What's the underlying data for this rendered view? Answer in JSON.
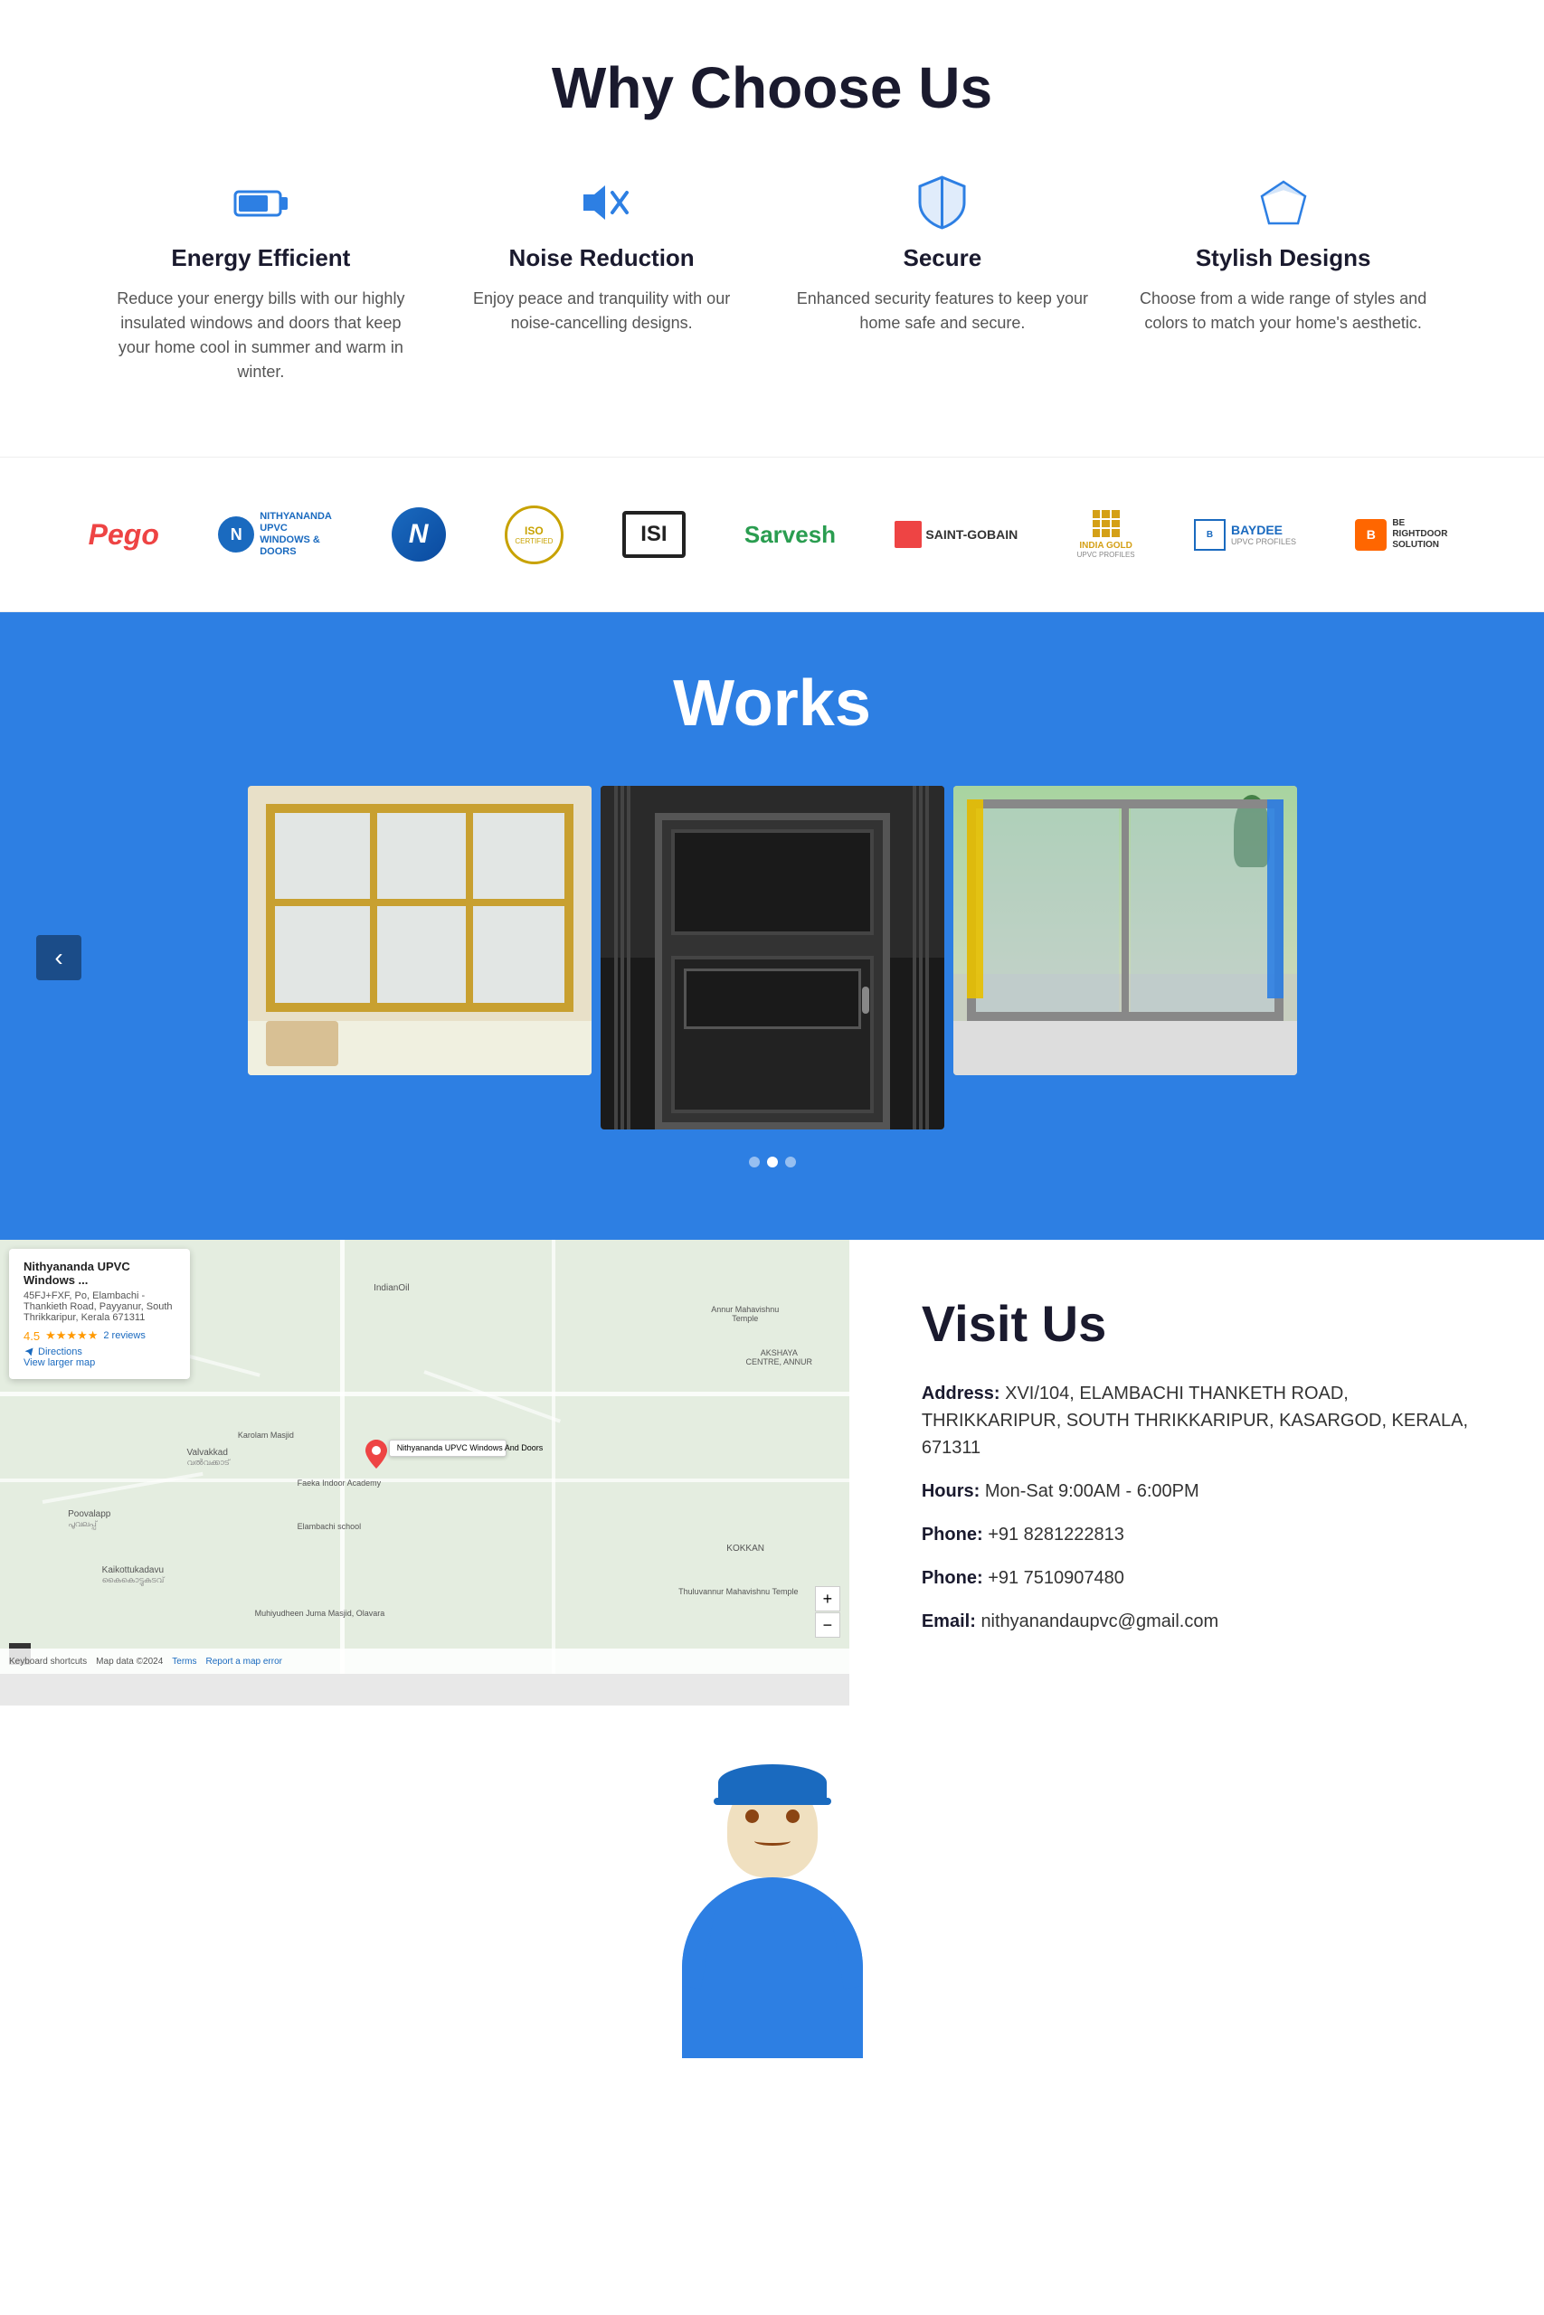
{
  "why": {
    "title": "Why Choose Us",
    "features": [
      {
        "id": "energy",
        "title": "Energy Efficient",
        "desc": "Reduce your energy bills with our highly insulated windows and doors that keep your home cool in summer and warm in winter.",
        "icon": "battery-icon"
      },
      {
        "id": "noise",
        "title": "Noise Reduction",
        "desc": "Enjoy peace and tranquility with our noise-cancelling designs.",
        "icon": "mute-icon"
      },
      {
        "id": "secure",
        "title": "Secure",
        "desc": "Enhanced security features to keep your home safe and secure.",
        "icon": "shield-icon"
      },
      {
        "id": "stylish",
        "title": "Stylish Designs",
        "desc": "Choose from a wide range of styles and colors to match your home's aesthetic.",
        "icon": "diamond-icon"
      }
    ]
  },
  "brands": {
    "items": [
      {
        "name": "Pego",
        "style": "pego"
      },
      {
        "name": "Nithyananda UPVC Windows & Doors",
        "style": "nithyananda"
      },
      {
        "name": "N",
        "style": "n-logo"
      },
      {
        "name": "ISO Certified",
        "style": "iso"
      },
      {
        "name": "ISI",
        "style": "isi"
      },
      {
        "name": "Sarvesh",
        "style": "sarvesh"
      },
      {
        "name": "SAINT-GOBAIN",
        "style": "saintgobain"
      },
      {
        "name": "INDIA GOLD UPVC PROFILES",
        "style": "india"
      },
      {
        "name": "BAYDEE UPVC PROFILES",
        "style": "baydee"
      },
      {
        "name": "BE RIGHTDOOR SOLUTION",
        "style": "be"
      }
    ]
  },
  "works": {
    "title": "Works",
    "images": [
      {
        "alt": "Yellow frame window installation"
      },
      {
        "alt": "Dark door installation"
      },
      {
        "alt": "Sliding window installation"
      }
    ],
    "dots": [
      false,
      true,
      false
    ]
  },
  "map": {
    "business_name": "Nithyananda UPVC Windows ...",
    "address": "45FJ+FXF, Po, Elambachi - Thankieth Road, Payyanur, South Thrikkaripur, Kerala 671311",
    "rating": "4.5",
    "stars": "★★★★★",
    "reviews_count": "2 reviews",
    "directions_label": "Directions",
    "view_larger": "View larger map",
    "labels": [
      "IndianOil",
      "Annur Mahavishnu Temple",
      "AKSHAYA CENTRE, ANNUR",
      "Valvakkad",
      "Poovalapp",
      "Kaikottukadavu",
      "Elambachi school",
      "Faeka Indoor Academy",
      "Karolam Masjid",
      "KOKKAN",
      "Thuluvannur Mahavishnu Temple",
      "Muhiyudheen Juma Masjid, Olavara"
    ],
    "pin_label": "Nithyananda UPVC Windows And Doors",
    "keyboard_shortcuts": "Keyboard shortcuts",
    "map_data": "Map data ©2024",
    "terms": "Terms",
    "report": "Report a map error"
  },
  "visit": {
    "title": "Visit Us",
    "address_label": "Address:",
    "address_value": "XVI/104, ELAMBACHI THANKETH ROAD, THRIKKARIPUR, SOUTH THRIKKARIPUR, KASARGOD, KERALA, 671311",
    "hours_label": "Hours:",
    "hours_value": "Mon-Sat 9:00AM - 6:00PM",
    "phone1_label": "Phone:",
    "phone1_value": "+91 8281222813",
    "phone2_label": "Phone:",
    "phone2_value": "+91 7510907480",
    "email_label": "Email:",
    "email_value": "nithyanandaupvc@gmail.com"
  }
}
